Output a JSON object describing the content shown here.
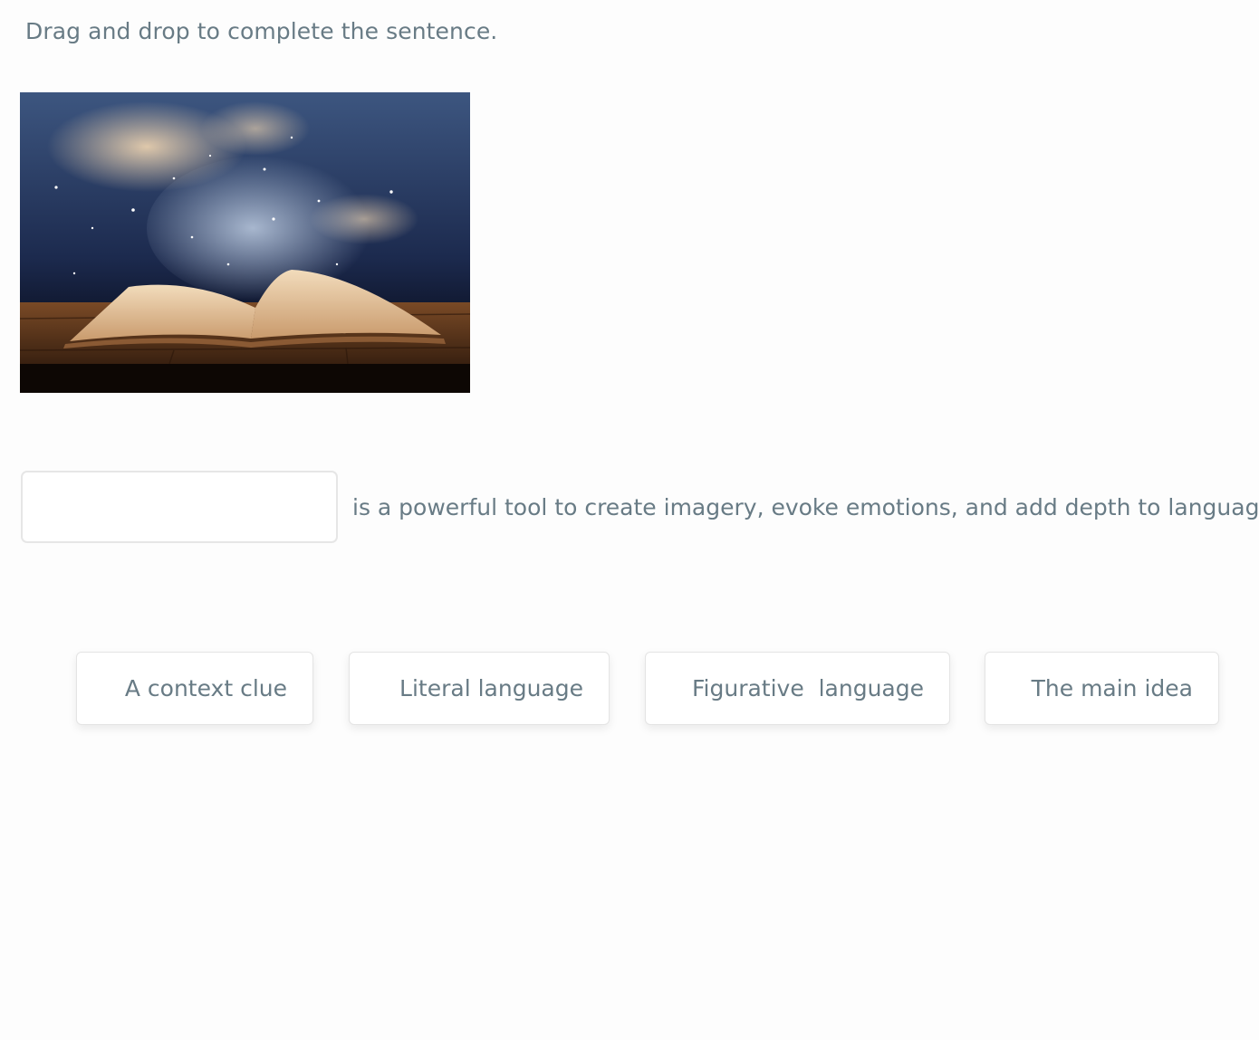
{
  "instructions": "Drag and drop to complete the sentence.",
  "image": {
    "alt": "open-book-night-sky"
  },
  "blank": {
    "value": ""
  },
  "sentence": "is a powerful tool to create imagery, evoke emotions, and add depth to language.",
  "choices": [
    {
      "label": "A context clue"
    },
    {
      "label": "Literal language"
    },
    {
      "label": "Figurative  language"
    },
    {
      "label": "The main idea"
    }
  ],
  "colors": {
    "text": "#687b85",
    "border": "#e4e4e4",
    "background": "#fdfdfd"
  }
}
